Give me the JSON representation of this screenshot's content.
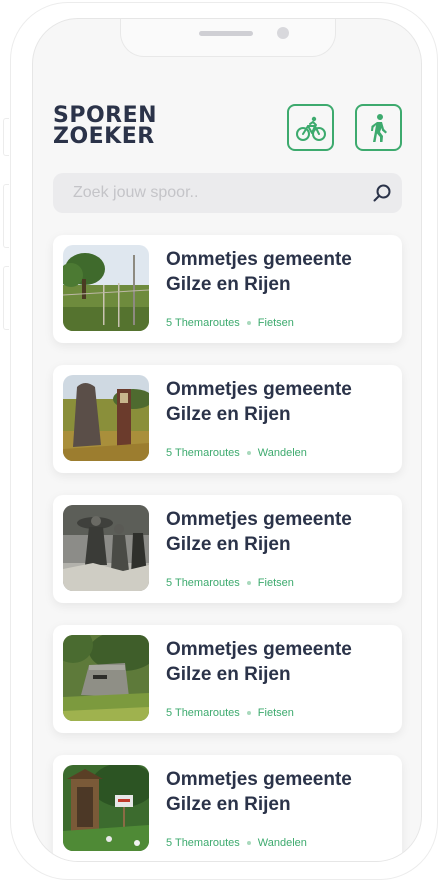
{
  "app": {
    "logo": {
      "line1": "SPOREN",
      "line2": "ZOEKER"
    },
    "modes": [
      {
        "name": "bike",
        "icon": "bicycle-icon"
      },
      {
        "name": "walk",
        "icon": "walking-icon"
      }
    ],
    "search": {
      "placeholder": "Zoek jouw spoor..",
      "value": "",
      "icon": "search-icon"
    },
    "colors": {
      "accent": "#3daa6e",
      "title": "#2b3349",
      "background": "#f7f7f7",
      "search_bg": "#ebebed"
    }
  },
  "routes": [
    {
      "title": "Ommetjes gemeente Gilze en Rijen",
      "count": "5 Themaroutes",
      "type": "Fietsen",
      "image": "field-trees-photo"
    },
    {
      "title": "Ommetjes gemeente Gilze en Rijen",
      "count": "5 Themaroutes",
      "type": "Wandelen",
      "image": "monument-stones-photo"
    },
    {
      "title": "Ommetjes gemeente Gilze en Rijen",
      "count": "5 Themaroutes",
      "type": "Fietsen",
      "image": "historic-soldiers-photo"
    },
    {
      "title": "Ommetjes gemeente Gilze en Rijen",
      "count": "5 Themaroutes",
      "type": "Fietsen",
      "image": "bunker-photo"
    },
    {
      "title": "Ommetjes gemeente Gilze en Rijen",
      "count": "5 Themaroutes",
      "type": "Wandelen",
      "image": "garden-kiosk-photo"
    }
  ]
}
